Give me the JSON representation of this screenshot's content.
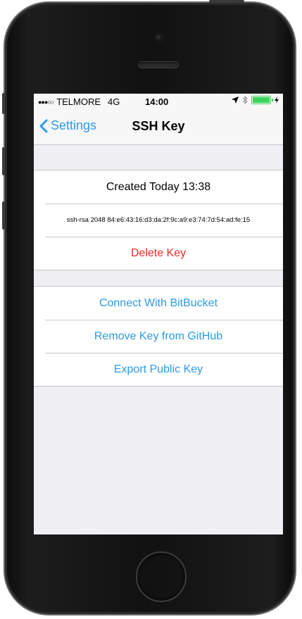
{
  "status_bar": {
    "carrier": "TELMORE",
    "network": "4G",
    "time": "14:00"
  },
  "nav": {
    "back_label": "Settings",
    "title": "SSH Key"
  },
  "key_info": {
    "created": "Created Today 13:38",
    "fingerprint": "ssh-rsa 2048 84:e6:43:16:d3:da:2f:9c:a9:e3:74:7d:54:ad:fe:15",
    "delete_label": "Delete Key"
  },
  "actions": {
    "connect_bitbucket": "Connect With BitBucket",
    "remove_github": "Remove Key from GitHub",
    "export_public": "Export Public Key"
  },
  "colors": {
    "accent": "#2d9ae5",
    "destructive": "#ee2a24",
    "battery": "#39d65a"
  }
}
